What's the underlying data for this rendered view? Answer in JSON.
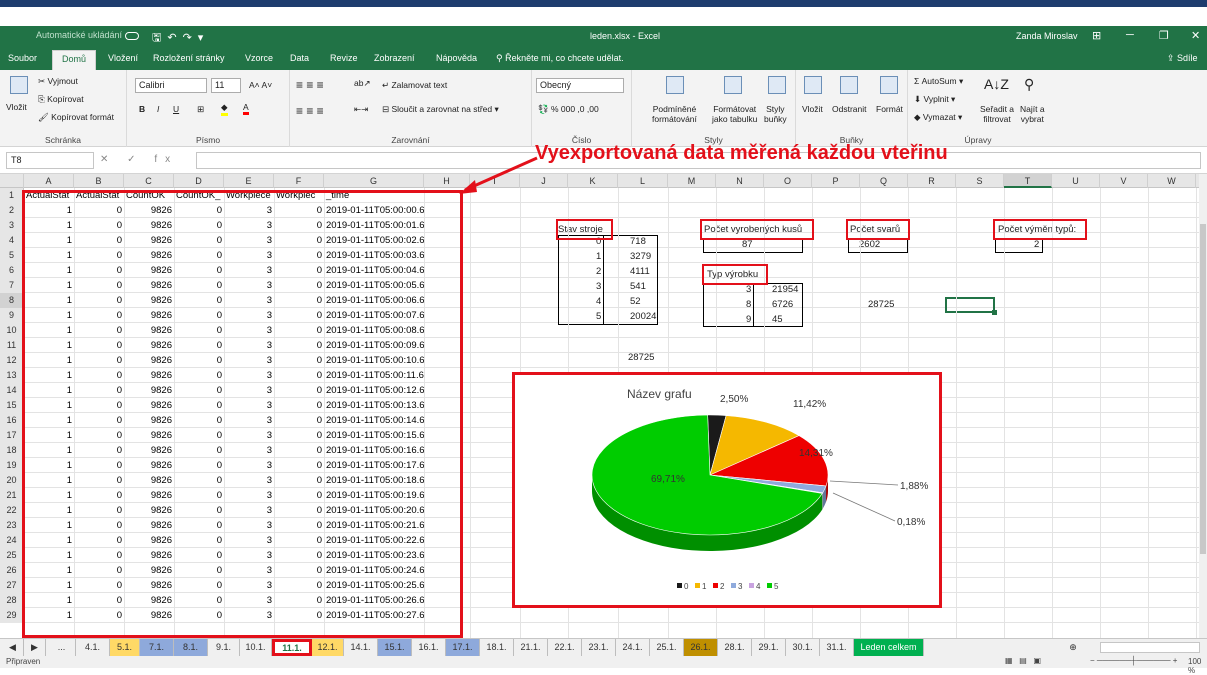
{
  "titlebar": {
    "autosave": "Automatické ukládání",
    "file_title": "leden.xlsx - Excel",
    "user": "Zanda Miroslav"
  },
  "menu": {
    "tabs": [
      "Soubor",
      "Domů",
      "Vložení",
      "Rozložení stránky",
      "Vzorce",
      "Data",
      "Revize",
      "Zobrazení",
      "Nápověda"
    ],
    "tellme": "Řekněte mi, co chcete udělat.",
    "share": "Sdíle"
  },
  "ribbon": {
    "paste": "Vložit",
    "cut": "Vyjmout",
    "copy": "Kopírovat",
    "format_painter": "Kopírovat formát",
    "clipboard": "Schránka",
    "font_name": "Calibri",
    "font_size": "11",
    "font_group": "Písmo",
    "wrap_text": "Zalamovat text",
    "merge_center": "Sloučit a zarovnat na střed",
    "alignment": "Zarovnání",
    "number_format": "Obecný",
    "number": "Číslo",
    "cond_format_1": "Podmíněné",
    "cond_format_2": "formátování",
    "format_table_1": "Formátovat",
    "format_table_2": "jako tabulku",
    "cell_styles_1": "Styly",
    "cell_styles_2": "buňky",
    "styles": "Styly",
    "insert": "Vložit",
    "delete": "Odstranit",
    "format": "Formát",
    "cells": "Buňky",
    "autosum": "AutoSum",
    "fill": "Vyplnit",
    "clear": "Vymazat",
    "sort_1": "Seřadit a",
    "sort_2": "filtrovat",
    "find_1": "Najít a",
    "find_2": "vybrat",
    "editing": "Úpravy"
  },
  "formula_bar": {
    "name_box": "T8",
    "fx": "fx",
    "formula": ""
  },
  "annotation": "Vyexportovaná data měřená každou vteřinu",
  "columns": [
    "A",
    "B",
    "C",
    "D",
    "E",
    "F",
    "G",
    "H",
    "I",
    "J",
    "K",
    "L",
    "M",
    "N",
    "O",
    "P",
    "Q",
    "R",
    "S",
    "T",
    "U",
    "V",
    "W",
    "X"
  ],
  "headers": [
    "ActualStat",
    "ActualStat",
    "CountOK",
    "CountOK_",
    "Workpiece",
    "Workpiec",
    "_time"
  ],
  "rows": [
    [
      "1",
      "0",
      "9826",
      "0",
      "3",
      "0",
      "2019-01-11T05:00:00.629Z"
    ],
    [
      "1",
      "0",
      "9826",
      "0",
      "3",
      "0",
      "2019-01-11T05:00:01.631Z"
    ],
    [
      "1",
      "0",
      "9826",
      "0",
      "3",
      "0",
      "2019-01-11T05:00:02.634Z"
    ],
    [
      "1",
      "0",
      "9826",
      "0",
      "3",
      "0",
      "2019-01-11T05:00:03.637Z"
    ],
    [
      "1",
      "0",
      "9826",
      "0",
      "3",
      "0",
      "2019-01-11T05:00:04.639Z"
    ],
    [
      "1",
      "0",
      "9826",
      "0",
      "3",
      "0",
      "2019-01-11T05:00:05.642Z"
    ],
    [
      "1",
      "0",
      "9826",
      "0",
      "3",
      "0",
      "2019-01-11T05:00:06.645Z"
    ],
    [
      "1",
      "0",
      "9826",
      "0",
      "3",
      "0",
      "2019-01-11T05:00:07.649Z"
    ],
    [
      "1",
      "0",
      "9826",
      "0",
      "3",
      "0",
      "2019-01-11T05:00:08.652Z"
    ],
    [
      "1",
      "0",
      "9826",
      "0",
      "3",
      "0",
      "2019-01-11T05:00:09.654Z"
    ],
    [
      "1",
      "0",
      "9826",
      "0",
      "3",
      "0",
      "2019-01-11T05:00:10.656Z"
    ],
    [
      "1",
      "0",
      "9826",
      "0",
      "3",
      "0",
      "2019-01-11T05:00:11.658Z"
    ],
    [
      "1",
      "0",
      "9826",
      "0",
      "3",
      "0",
      "2019-01-11T05:00:12.661Z"
    ],
    [
      "1",
      "0",
      "9826",
      "0",
      "3",
      "0",
      "2019-01-11T05:00:13.663Z"
    ],
    [
      "1",
      "0",
      "9826",
      "0",
      "3",
      "0",
      "2019-01-11T05:00:14.667Z"
    ],
    [
      "1",
      "0",
      "9826",
      "0",
      "3",
      "0",
      "2019-01-11T05:00:15.669Z"
    ],
    [
      "1",
      "0",
      "9826",
      "0",
      "3",
      "0",
      "2019-01-11T05:00:16.672Z"
    ],
    [
      "1",
      "0",
      "9826",
      "0",
      "3",
      "0",
      "2019-01-11T05:00:17.674Z"
    ],
    [
      "1",
      "0",
      "9826",
      "0",
      "3",
      "0",
      "2019-01-11T05:00:18.676Z"
    ],
    [
      "1",
      "0",
      "9826",
      "0",
      "3",
      "0",
      "2019-01-11T05:00:19.678Z"
    ],
    [
      "1",
      "0",
      "9826",
      "0",
      "3",
      "0",
      "2019-01-11T05:00:20.681Z"
    ],
    [
      "1",
      "0",
      "9826",
      "0",
      "3",
      "0",
      "2019-01-11T05:00:21.683Z"
    ],
    [
      "1",
      "0",
      "9826",
      "0",
      "3",
      "0",
      "2019-01-11T05:00:22.686Z"
    ],
    [
      "1",
      "0",
      "9826",
      "0",
      "3",
      "0",
      "2019-01-11T05:00:23.689Z"
    ],
    [
      "1",
      "0",
      "9826",
      "0",
      "3",
      "0",
      "2019-01-11T05:00:24.691Z"
    ],
    [
      "1",
      "0",
      "9826",
      "0",
      "3",
      "0",
      "2019-01-11T05:00:25.694Z"
    ],
    [
      "1",
      "0",
      "9826",
      "0",
      "3",
      "0",
      "2019-01-11T05:00:26.696Z"
    ],
    [
      "1",
      "0",
      "9826",
      "0",
      "3",
      "0",
      "2019-01-11T05:00:27.698Z"
    ]
  ],
  "summary": {
    "stav_label": "Stav stroje",
    "stav": [
      [
        "0",
        "718"
      ],
      [
        "1",
        "3279"
      ],
      [
        "2",
        "4111"
      ],
      [
        "3",
        "541"
      ],
      [
        "4",
        "52"
      ],
      [
        "5",
        "20024"
      ]
    ],
    "stav_total": "28725",
    "pocet_kusu_label": "Počet vyrobených kusů",
    "pocet_kusu": "87",
    "pocet_svaru_label": "Počet svarů",
    "pocet_svaru": "2602",
    "pocet_vymen_label": "Počet výměn typů:",
    "pocet_vymen": "2",
    "typ_label": "Typ výrobku",
    "typ": [
      [
        "3",
        "21954"
      ],
      [
        "8",
        "6726"
      ],
      [
        "9",
        "45"
      ]
    ],
    "r8_value": "28725"
  },
  "chart_data": {
    "type": "pie",
    "title": "Název grafu",
    "categories": [
      "0",
      "1",
      "2",
      "3",
      "4",
      "5"
    ],
    "values": [
      2.5,
      11.42,
      14.31,
      1.88,
      0.18,
      69.71
    ],
    "labels": [
      "2,50%",
      "11,42%",
      "14,31%",
      "1,88%",
      "0,18%",
      "69,71%"
    ],
    "colors": [
      "#1a1a1a",
      "#f5b800",
      "#ee0000",
      "#8faadc",
      "#c9a3e0",
      "#00cc00"
    ],
    "legend_position": "bottom"
  },
  "sheet_tabs": [
    "...",
    "4.1.",
    "5.1.",
    "7.1.",
    "8.1.",
    "9.1.",
    "10.1.",
    "11.1.",
    "12.1.",
    "14.1.",
    "15.1.",
    "16.1.",
    "17.1.",
    "18.1.",
    "21.1.",
    "22.1.",
    "23.1.",
    "24.1.",
    "25.1.",
    "26.1.",
    "28.1.",
    "29.1.",
    "30.1.",
    "31.1.",
    "Leden celkem"
  ],
  "sheet_tab_colors": [
    "",
    "",
    "#ffd966",
    "#8ea9db",
    "#8ea9db",
    "",
    "",
    "",
    "#ffd966",
    "",
    "#8ea9db",
    "",
    "#8ea9db",
    "",
    "",
    "",
    "",
    "",
    "",
    "#bf8f00",
    "",
    "",
    "",
    "",
    "#00b050"
  ],
  "active_sheet": "11.1.",
  "status": {
    "left": "Připraven",
    "zoom": "100 %"
  }
}
